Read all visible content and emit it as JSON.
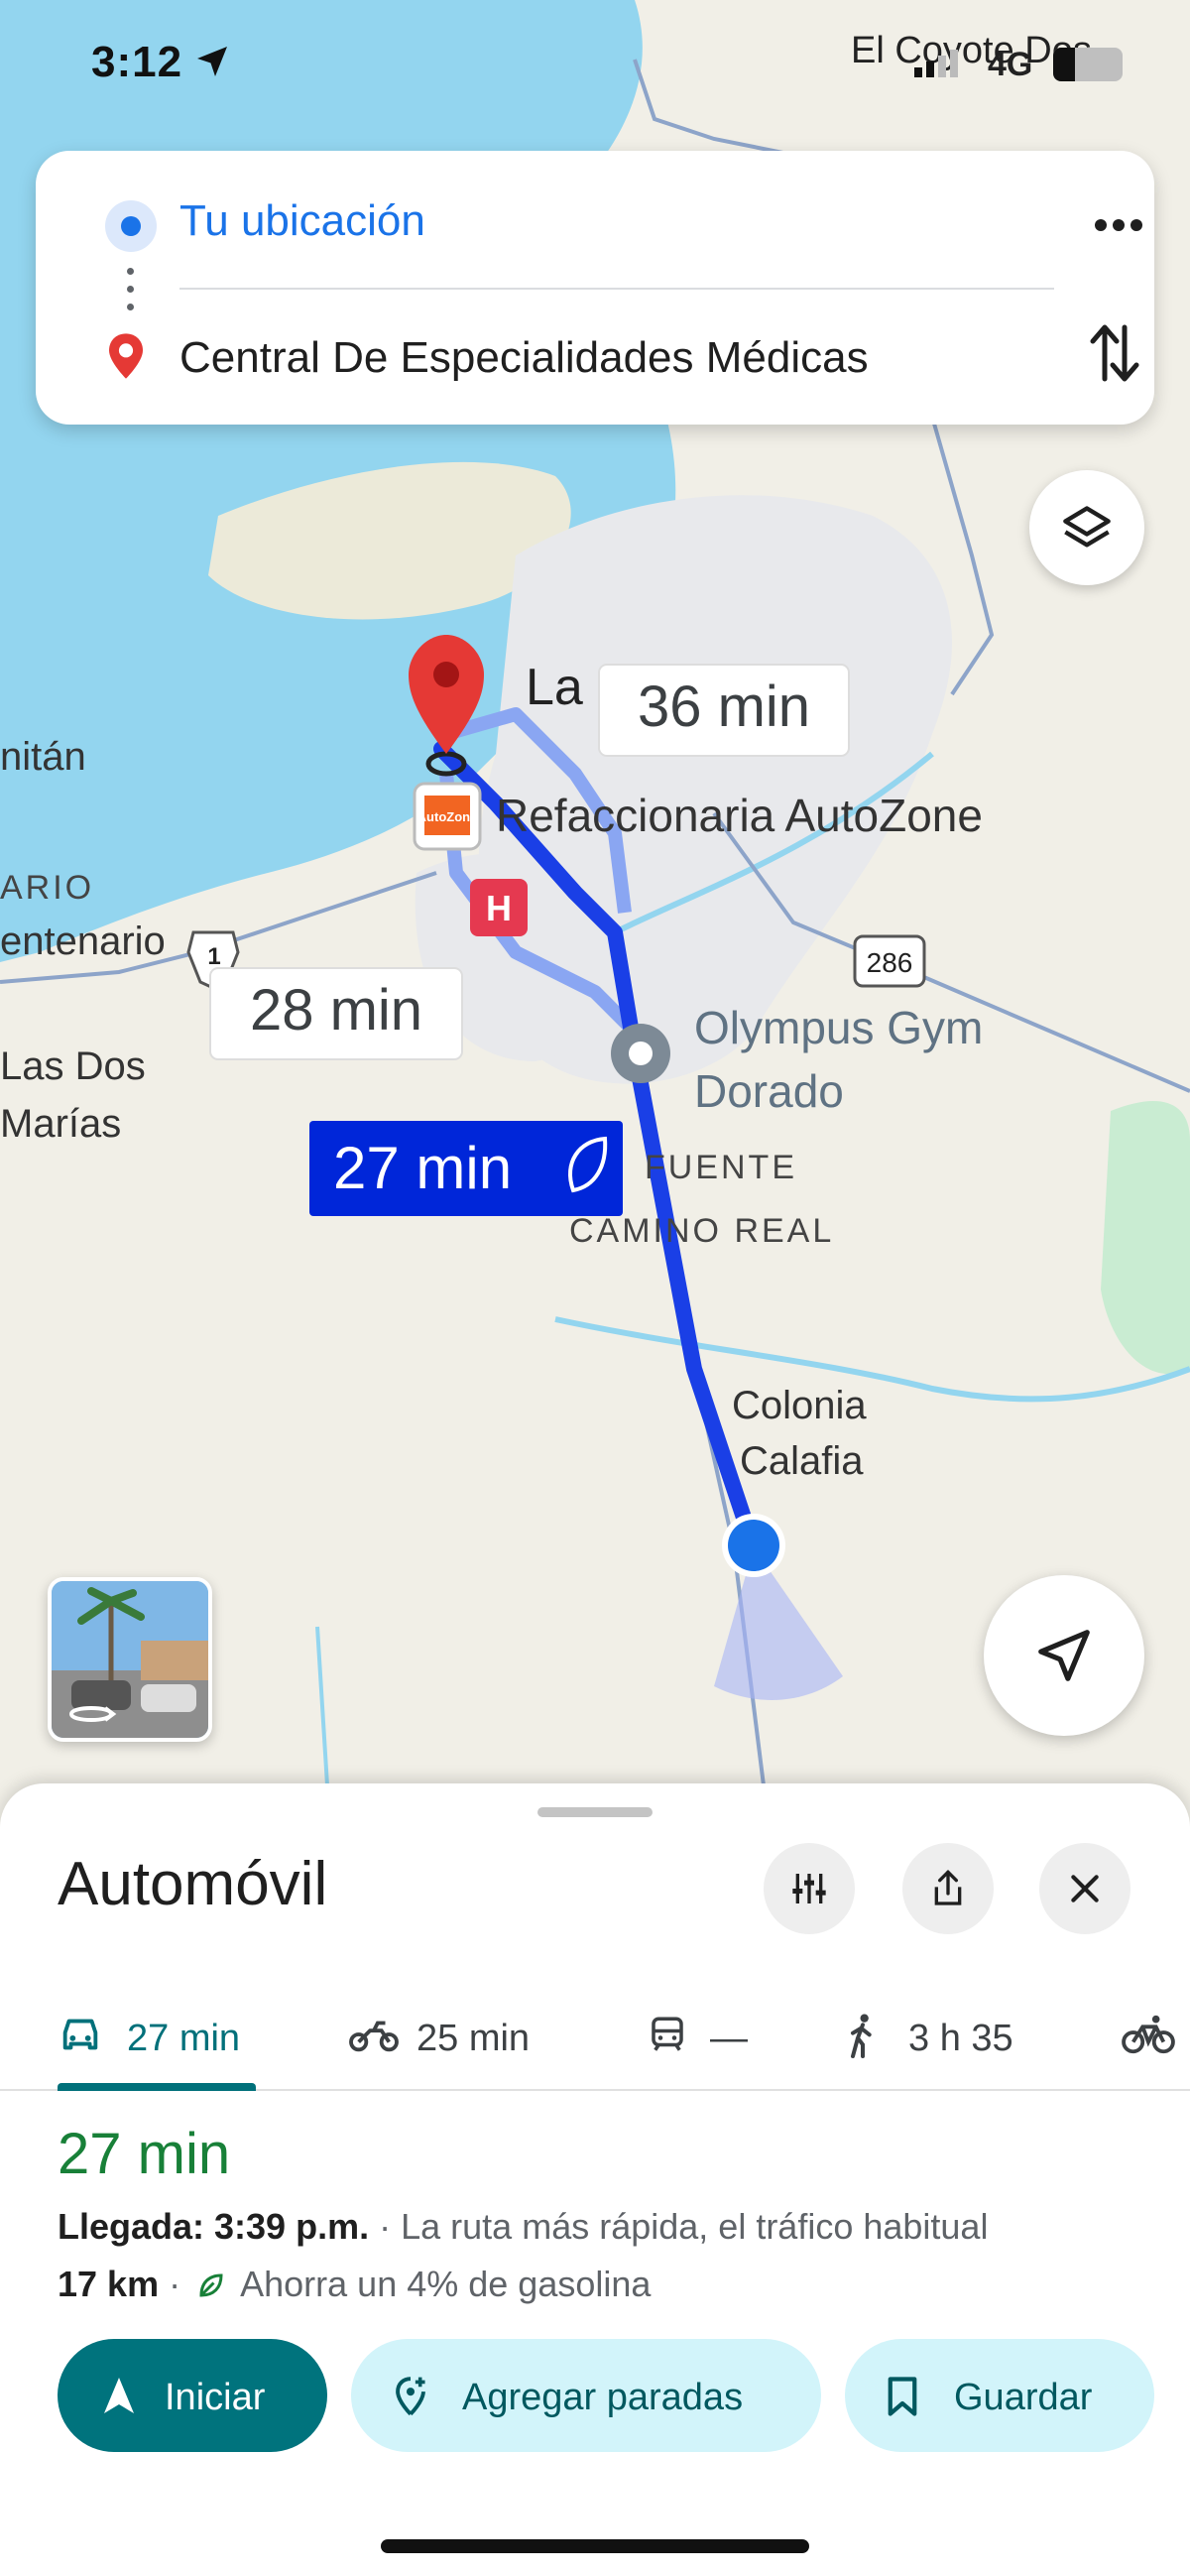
{
  "status_bar": {
    "time": "3:12",
    "carrier": "El Coyote Dos",
    "network": "4G"
  },
  "directions": {
    "origin": "Tu ubicación",
    "destination": "Central De Especialidades Médicas"
  },
  "map": {
    "labels": {
      "la": "La",
      "autozone": "Refaccionaria AutoZone",
      "autozone_logo": "AutoZone",
      "hospital": "H",
      "olympus_line1": "Olympus Gym",
      "olympus_line2": "Dorado",
      "la_fuente": "FUENTE",
      "camino_real": "CAMINO REAL",
      "calafia_line1": "Colonia",
      "calafia_line2": "Calafia",
      "las_dos_line1": "Las Dos",
      "las_dos_line2": "Marías",
      "mitan": "nitán",
      "ario": "ARIO",
      "centenario": "entenario",
      "hwy1": "1",
      "hwy286": "286"
    },
    "route_badges": {
      "alt1": "36 min",
      "alt2": "28 min",
      "primary": "27 min"
    }
  },
  "sheet": {
    "mode_title": "Automóvil",
    "tabs": [
      {
        "label": "27 min",
        "icon": "car-icon"
      },
      {
        "label": "25 min",
        "icon": "motorcycle-icon"
      },
      {
        "label": "—",
        "icon": "transit-icon"
      },
      {
        "label": "3 h 35",
        "icon": "walk-icon"
      },
      {
        "label": "",
        "icon": "bike-icon"
      }
    ],
    "route": {
      "time": "27 min",
      "arrival_label": "Llegada: 3:39 p.m.",
      "separator": "·",
      "description": "La ruta más rápida, el tráfico habitual",
      "distance": "17 km",
      "eco": "Ahorra un 4% de gasolina"
    },
    "buttons": {
      "start": "Iniciar",
      "add_stops": "Agregar paradas",
      "save": "Guardar"
    }
  },
  "colors": {
    "route_primary": "#1a3fe6",
    "route_alt": "#8aa6f2",
    "accent": "#00737d",
    "water": "#93d5ef",
    "land": "#f1efe7"
  }
}
